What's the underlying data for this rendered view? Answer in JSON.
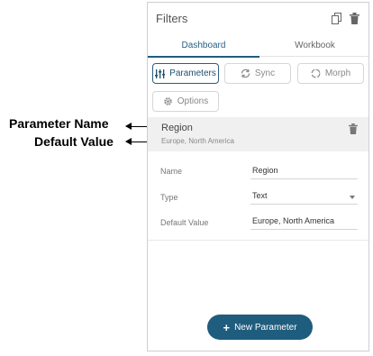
{
  "annotations": {
    "parameter_name": "Parameter  Name",
    "default_value": "Default Value"
  },
  "panel": {
    "title": "Filters",
    "icons": [
      "copy-icon",
      "trash-icon"
    ],
    "tabs": [
      {
        "label": "Dashboard",
        "active": true
      },
      {
        "label": "Workbook",
        "active": false
      }
    ],
    "buttons": {
      "parameters": "Parameters",
      "sync": "Sync",
      "morph": "Morph",
      "options": "Options"
    },
    "parameter": {
      "name": "Region",
      "default": "Europe, North America"
    },
    "form": {
      "name_label": "Name",
      "name_value": "Region",
      "type_label": "Type",
      "type_value": "Text",
      "default_label": "Default Value",
      "default_value": "Europe, North America"
    },
    "new_button": "New Parameter"
  },
  "colors": {
    "accent": "#1f5d7e",
    "active_tab": "#2a5f86",
    "row_bg": "#f0f0f0"
  }
}
